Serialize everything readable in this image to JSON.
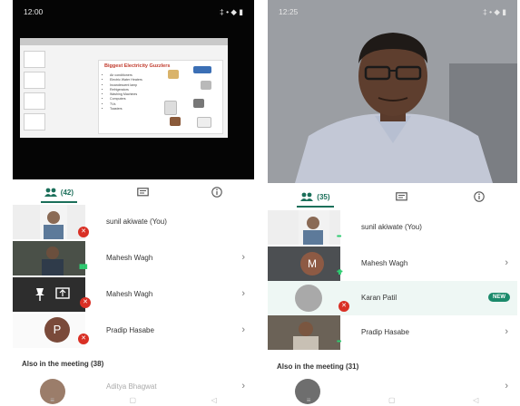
{
  "left_phone": {
    "status_time": "12:00",
    "status_icons": "‡ • ◆ ▮",
    "slide": {
      "title": "Biggest Electricity Guzzlers",
      "bullets": [
        "Air conditioners",
        "Electric Water Heaters",
        "Incandescent lamp",
        "Refrigerators",
        "Washing Machines",
        "Computers",
        "TVs",
        "Toasters"
      ]
    },
    "tabs": [
      {
        "label": "(42)",
        "icon": "people-icon"
      },
      {
        "label": "",
        "icon": "chat-icon"
      },
      {
        "label": "",
        "icon": "info-icon"
      }
    ],
    "participants": [
      {
        "name": "sunil akiwate (You)"
      },
      {
        "name": "Mahesh Wagh"
      },
      {
        "name": "Mahesh Wagh"
      },
      {
        "name": "Pradip Hasabe",
        "initial": "P"
      },
      {
        "name": "Aditya Bhagwat"
      }
    ],
    "also_label": "Also in the meeting (38)"
  },
  "right_phone": {
    "status_time": "12:25",
    "status_icons": "‡ • ◆ ▮",
    "tabs": [
      {
        "label": "(35)",
        "icon": "people-icon"
      },
      {
        "label": "",
        "icon": "chat-icon"
      },
      {
        "label": "",
        "icon": "info-icon"
      }
    ],
    "participants": [
      {
        "name": "sunil akiwate (You)"
      },
      {
        "name": "Mahesh Wagh",
        "initial": "M"
      },
      {
        "name": "Karan Patil",
        "badge": "NEW"
      },
      {
        "name": "Pradip Hasabe"
      }
    ],
    "also_label": "Also in the meeting (31)"
  },
  "colors": {
    "accent": "#1b6f5a",
    "mute": "#d93025",
    "badge": "#1b8a6b"
  }
}
